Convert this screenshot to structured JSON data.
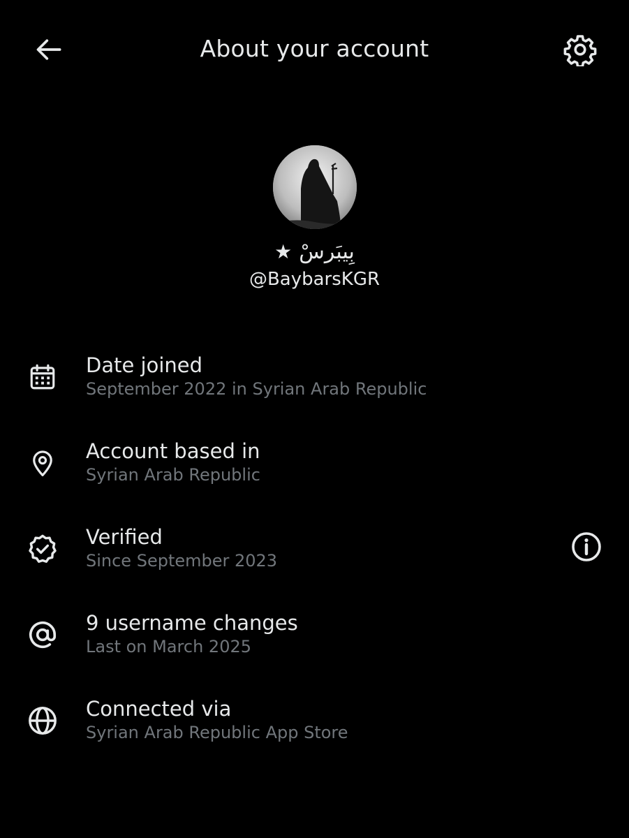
{
  "header": {
    "title": "About your account",
    "back_icon": "arrow-left-icon",
    "settings_icon": "gear-icon"
  },
  "profile": {
    "display_name": "بِيبَرسْ",
    "star": "★",
    "handle": "@BaybarsKGR"
  },
  "rows": [
    {
      "icon": "calendar-icon",
      "title": "Date joined",
      "subtitle": "September 2022 in Syrian Arab Republic"
    },
    {
      "icon": "location-pin-icon",
      "title": "Account based in",
      "subtitle": "Syrian Arab Republic"
    },
    {
      "icon": "verified-badge-icon",
      "title": "Verified",
      "subtitle": "Since September 2023",
      "action_icon": "info-icon"
    },
    {
      "icon": "at-sign-icon",
      "title": "9 username changes",
      "subtitle": "Last on March 2025"
    },
    {
      "icon": "globe-icon",
      "title": "Connected via",
      "subtitle": "Syrian Arab Republic App Store"
    }
  ],
  "colors": {
    "background": "#000000",
    "primary_text": "#e7e9ea",
    "secondary_text": "#71767b"
  }
}
